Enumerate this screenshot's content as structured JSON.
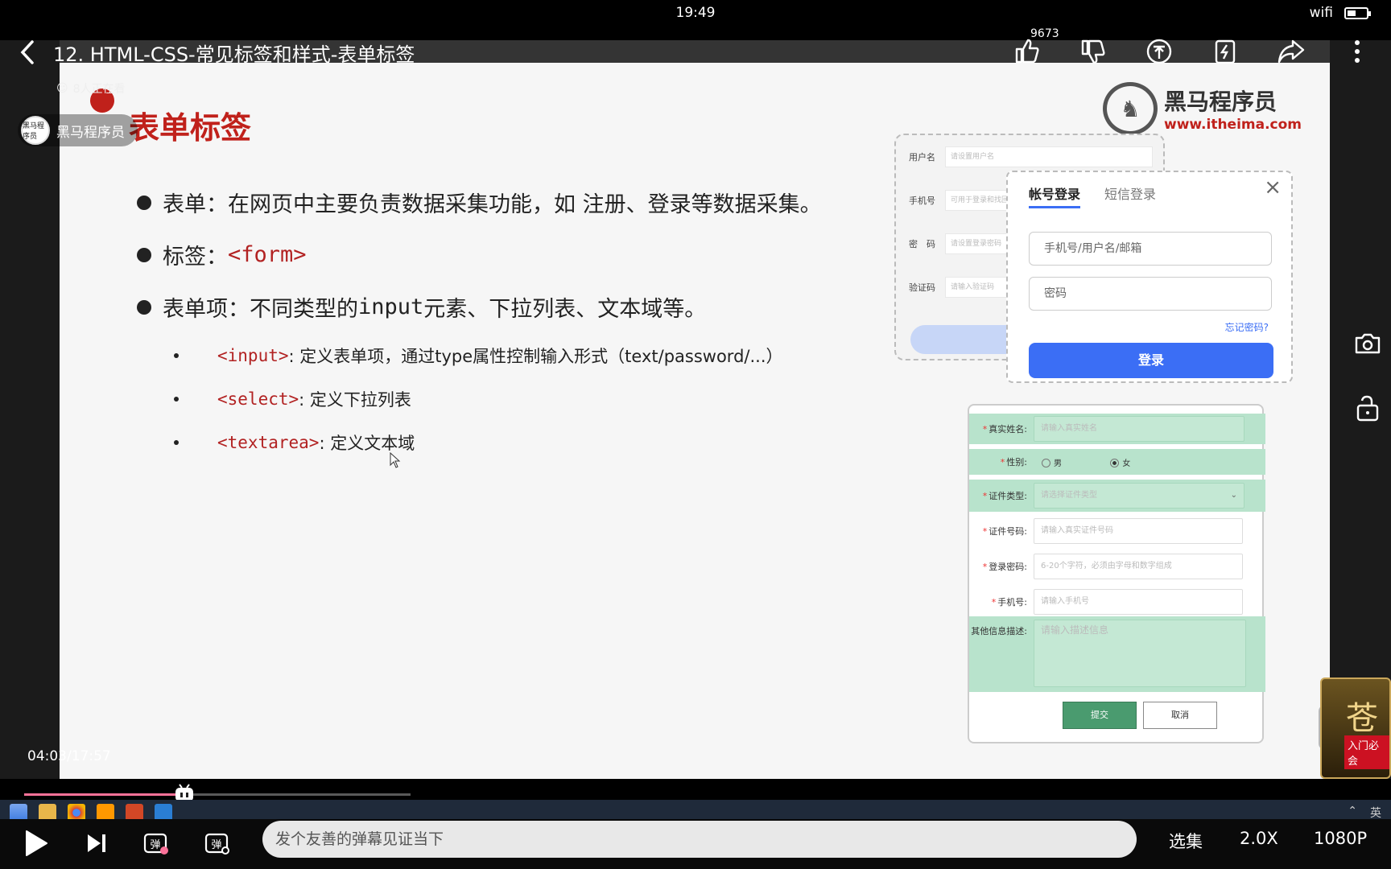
{
  "status": {
    "time": "19:49",
    "network": "wifi"
  },
  "video": {
    "title": "12. HTML-CSS-常见标签和样式-表单标签",
    "like_count": "9673",
    "viewers": "8人正在看",
    "uploader": "黑马程序员",
    "uploader_avatar_text": "黑马程序员",
    "timestamp": "04:03/17:57",
    "progress": 0.23
  },
  "slide": {
    "heading": "表单标签",
    "brand_name": "黑马程序员",
    "brand_url": "www.itheima.com",
    "bullets": {
      "b1": "表单：在网页中主要负责数据采集功能，如 注册、登录等数据采集。",
      "b2_label": "标签：",
      "b2_code": "<form>",
      "b3_label": "表单项：不同类型的 ",
      "b3_mono": "input",
      "b3_rest": " 元素、下拉列表、文本域等。",
      "s1_code": "<input>",
      "s1_text": ": 定义表单项，通过type属性控制输入形式（text/password/...）",
      "s2_code": "<select>",
      "s2_text": ": 定义下拉列表",
      "s3_code": "<textarea>",
      "s3_text": ": 定义文本域"
    },
    "bg_form": {
      "rows": [
        {
          "label": "用户名",
          "placeholder": "请设置用户名"
        },
        {
          "label": "手机号",
          "placeholder": "可用于登录和找回密码"
        },
        {
          "label": "密　码",
          "placeholder": "请设置登录密码"
        },
        {
          "label": "验证码",
          "placeholder": "请输入验证码"
        }
      ]
    },
    "login": {
      "tab_account": "帐号登录",
      "tab_sms": "短信登录",
      "close": "×",
      "account_placeholder": "手机号/用户名/邮箱",
      "password_placeholder": "密码",
      "forgot": "忘记密码?",
      "submit": "登录"
    },
    "register": {
      "name_label": "真实姓名:",
      "name_placeholder": "请输入真实姓名",
      "gender_label": "性别:",
      "male": "男",
      "female": "女",
      "idtype_label": "证件类型:",
      "idtype_placeholder": "请选择证件类型",
      "idno_label": "证件号码:",
      "idno_placeholder": "请输入真实证件号码",
      "pwd_label": "登录密码:",
      "pwd_placeholder": "6-20个字符，必须由字母和数字组成",
      "phone_label": "手机号:",
      "phone_placeholder": "请输入手机号",
      "desc_label": "其他信息描述:",
      "desc_placeholder": "请输入描述信息",
      "submit": "提交",
      "cancel": "取消"
    }
  },
  "ad": {
    "title": "苍",
    "tag": "入门必会"
  },
  "taskbar": {
    "ime": "英"
  },
  "controls": {
    "danmaku_placeholder": "发个友善的弹幕见证当下",
    "episodes": "选集",
    "speed": "2.0X",
    "quality": "1080P"
  }
}
